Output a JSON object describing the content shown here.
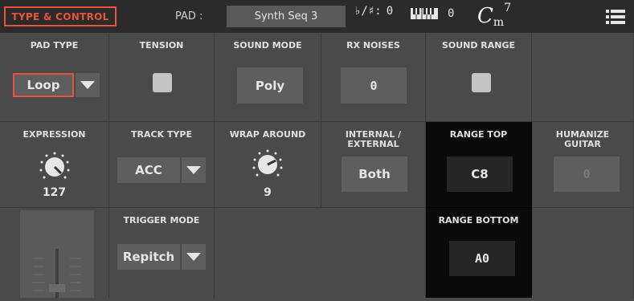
{
  "header": {
    "title": "TYPE & CONTROL",
    "pad_label": "PAD :",
    "pad_value": "Synth Seq 3",
    "key_sig_label": "♭/♯:",
    "key_sig_value": "0",
    "transpose_value": "0",
    "chord_root": "C",
    "chord_quality": "m",
    "chord_ext": "7",
    "icons": {
      "keyboard": "keyboard-icon",
      "menu": "menu-icon"
    }
  },
  "params": {
    "pad_type": {
      "label": "PAD TYPE",
      "value": "Loop"
    },
    "tension": {
      "label": "TENSION",
      "checked": false
    },
    "sound_mode": {
      "label": "SOUND MODE",
      "value": "Poly"
    },
    "rx_noises": {
      "label": "RX NOISES",
      "value": "0"
    },
    "sound_range": {
      "label": "SOUND RANGE",
      "checked": false
    },
    "expression": {
      "label": "EXPRESSION",
      "value": "127"
    },
    "track_type": {
      "label": "TRACK TYPE",
      "value": "ACC"
    },
    "wrap_around": {
      "label": "WRAP AROUND",
      "value": "9"
    },
    "internal_external": {
      "label_line1": "INTERNAL /",
      "label_line2": "EXTERNAL",
      "value": "Both"
    },
    "range_top": {
      "label": "RANGE TOP",
      "value": "C8"
    },
    "humanize_guitar": {
      "label_line1": "HUMANIZE",
      "label_line2": "GUITAR",
      "value": "0"
    },
    "trigger_mode": {
      "label": "TRIGGER MODE",
      "value": "Repitch"
    },
    "range_bottom": {
      "label": "RANGE BOTTOM",
      "value": "A0"
    }
  },
  "colors": {
    "accent": "#e8553a",
    "panel": "#4a4a4a",
    "topbar": "#2b2b2b",
    "highlight": "#0a0a0a"
  }
}
